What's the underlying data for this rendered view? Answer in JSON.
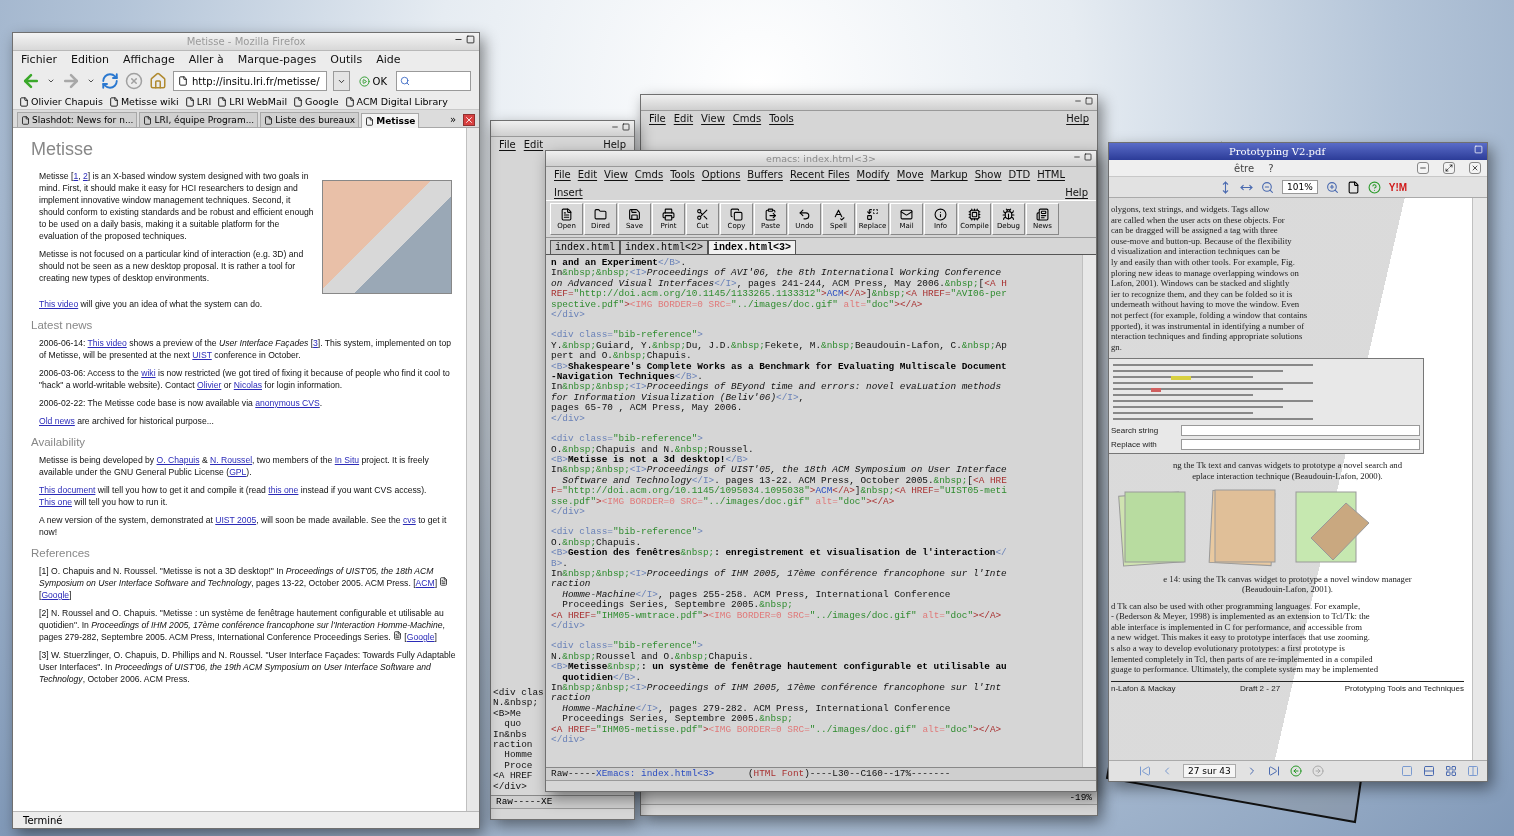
{
  "browser": {
    "title": "Metisse - Mozilla Firefox",
    "menu": [
      "Fichier",
      "Edition",
      "Affichage",
      "Aller à",
      "Marque-pages",
      "Outils",
      "Aide"
    ],
    "url": "http://insitu.lri.fr/metisse/",
    "go_label": "OK",
    "bookmarks": [
      "Olivier Chapuis",
      "Metisse wiki",
      "LRI",
      "LRI WebMail",
      "Google",
      "ACM Digital Library"
    ],
    "tabs": [
      {
        "label": "Slashdot: News for n...",
        "selected": false
      },
      {
        "label": "LRI, équipe Program...",
        "selected": false
      },
      {
        "label": "Liste des bureaux",
        "selected": false
      },
      {
        "label": "Metisse",
        "selected": true
      }
    ],
    "tabs_overflow": "»",
    "page": {
      "title": "Metisse",
      "intro": [
        [
          {
            "kind": "text",
            "text": "Metisse ["
          },
          {
            "kind": "link",
            "text": "1"
          },
          {
            "kind": "text",
            "text": ", "
          },
          {
            "kind": "link",
            "text": "2"
          },
          {
            "kind": "text",
            "text": "] is an X-based window system designed with two goals in mind. First, it should make it easy for HCI researchers to design and implement innovative window management techniques. Second, it should conform to existing standards and be robust and efficient enough to be used on a daily basis, making it a suitable platform for the evaluation of the proposed techniques."
          }
        ],
        [
          {
            "kind": "text",
            "text": "Metisse is not focused on a particular kind of interaction (e.g. 3D) and should not be seen as a new desktop proposal. It is rather a tool for creating new types of desktop environments."
          }
        ],
        [
          {
            "kind": "link",
            "text": "This video"
          },
          {
            "kind": "text",
            "text": " will give you an idea of what the system can do."
          }
        ]
      ],
      "sections": [
        {
          "heading": "Latest news",
          "paragraphs": [
            [
              {
                "kind": "text",
                "text": "2006-06-14: "
              },
              {
                "kind": "link",
                "text": "This video"
              },
              {
                "kind": "text",
                "text": " shows a preview of the "
              },
              {
                "kind": "italic",
                "text": "User Interface Façades"
              },
              {
                "kind": "text",
                "text": " ["
              },
              {
                "kind": "link",
                "text": "3"
              },
              {
                "kind": "text",
                "text": "]. This system, implemented on top of Metisse, will be presented at the next "
              },
              {
                "kind": "link",
                "text": "UIST"
              },
              {
                "kind": "text",
                "text": " conference in October."
              }
            ],
            [
              {
                "kind": "text",
                "text": "2006-03-06: Access to the "
              },
              {
                "kind": "link",
                "text": "wiki"
              },
              {
                "kind": "text",
                "text": " is now restricted (we got tired of fixing it because of people who find it cool to \"hack\" a world-writable website). Contact "
              },
              {
                "kind": "link",
                "text": "Olivier"
              },
              {
                "kind": "text",
                "text": " or "
              },
              {
                "kind": "link",
                "text": "Nicolas"
              },
              {
                "kind": "text",
                "text": " for login information."
              }
            ],
            [
              {
                "kind": "text",
                "text": "2006-02-22: The Metisse code base is now available via "
              },
              {
                "kind": "link",
                "text": "anonymous CVS"
              },
              {
                "kind": "text",
                "text": "."
              }
            ],
            [
              {
                "kind": "link",
                "text": "Old news"
              },
              {
                "kind": "text",
                "text": " are archived for historical purpose..."
              }
            ]
          ]
        },
        {
          "heading": "Availability",
          "paragraphs": [
            [
              {
                "kind": "text",
                "text": "Metisse is being developed by "
              },
              {
                "kind": "link",
                "text": "O. Chapuis"
              },
              {
                "kind": "text",
                "text": " & "
              },
              {
                "kind": "link",
                "text": "N. Roussel"
              },
              {
                "kind": "text",
                "text": ", two members of the "
              },
              {
                "kind": "link",
                "text": "In Situ"
              },
              {
                "kind": "text",
                "text": " project. It is freely available under the GNU General Public License ("
              },
              {
                "kind": "link",
                "text": "GPL"
              },
              {
                "kind": "text",
                "text": ")."
              }
            ],
            [
              {
                "kind": "link",
                "text": "This document"
              },
              {
                "kind": "text",
                "text": " will tell you how to get it and compile it (read "
              },
              {
                "kind": "link",
                "text": "this one"
              },
              {
                "kind": "text",
                "text": " instead if you want CVS access). "
              },
              {
                "kind": "link",
                "text": "This one"
              },
              {
                "kind": "text",
                "text": " will tell you how to run it."
              }
            ],
            [
              {
                "kind": "text",
                "text": "A new version of the system, demonstrated at "
              },
              {
                "kind": "link",
                "text": "UIST 2005"
              },
              {
                "kind": "text",
                "text": ", will soon be made available. See the "
              },
              {
                "kind": "link",
                "text": "cvs"
              },
              {
                "kind": "text",
                "text": " to get it now!"
              }
            ]
          ]
        },
        {
          "heading": "References",
          "paragraphs": [
            [
              {
                "kind": "text",
                "text": "[1] O. Chapuis and N. Roussel. \"Metisse is not a 3D desktop!\" In "
              },
              {
                "kind": "italic",
                "text": "Proceedings of UIST'05, the 18th ACM Symposium on User Interface Software and Technology"
              },
              {
                "kind": "text",
                "text": ", pages 13-22, October 2005. ACM Press. ["
              },
              {
                "kind": "link",
                "text": "ACM"
              },
              {
                "kind": "text",
                "text": "] "
              },
              {
                "kind": "icon"
              },
              {
                "kind": "text",
                "text": " ["
              },
              {
                "kind": "link",
                "text": "Google"
              },
              {
                "kind": "text",
                "text": "]"
              }
            ],
            [
              {
                "kind": "text",
                "text": "[2] N. Roussel and O. Chapuis. \"Metisse : un système de fenêtrage hautement configurable et utilisable au quotidien\". In "
              },
              {
                "kind": "italic",
                "text": "Proceedings of IHM 2005, 17ème conférence francophone sur l'Interaction Homme-Machine"
              },
              {
                "kind": "text",
                "text": ", pages 279-282, Septembre 2005. ACM Press, International Conference Proceedings Series. "
              },
              {
                "kind": "icon"
              },
              {
                "kind": "text",
                "text": " ["
              },
              {
                "kind": "link",
                "text": "Google"
              },
              {
                "kind": "text",
                "text": "]"
              }
            ],
            [
              {
                "kind": "text",
                "text": "[3] W. Stuerzlinger, O. Chapuis, D. Phillips and N. Roussel. \"User Interface Façades: Towards Fully Adaptable User Interfaces\". In "
              },
              {
                "kind": "italic",
                "text": "Proceedings of UIST'06, the 19th ACM Symposium on User Interface Software and Technology"
              },
              {
                "kind": "text",
                "text": ", October 2006. ACM Press."
              }
            ]
          ]
        }
      ]
    },
    "status": "Terminé"
  },
  "back_editors": [
    {
      "menu": [
        "File",
        "Edit"
      ],
      "help": "Help",
      "fragments": [
        "<div clas",
        "N.&nbsp;",
        "<B>Me",
        "  quo",
        "In&nbs",
        "raction",
        "  Homme",
        "  Proce",
        "<A HREF",
        "</div>"
      ],
      "mode_line": "Raw-----XE"
    },
    {
      "menu": [
        "File",
        "Edit",
        "View",
        "Cmds",
        "Tools"
      ],
      "help": "Help",
      "mode_line": "-19%"
    }
  ],
  "editor": {
    "title": "emacs: index.html<3>",
    "menu": [
      "File",
      "Edit",
      "View",
      "Cmds",
      "Tools",
      "Options",
      "Buffers",
      "Recent Files",
      "Modify",
      "Move",
      "Markup",
      "Show",
      "DTD",
      "HTML",
      "Insert"
    ],
    "help": "Help",
    "toolbar": [
      "Open",
      "Dired",
      "Save",
      "Print",
      "Cut",
      "Copy",
      "Paste",
      "Undo",
      "Spell",
      "Replace",
      "Mail",
      "Info",
      "Compile",
      "Debug",
      "News"
    ],
    "buffers": [
      {
        "label": "index.html",
        "selected": false
      },
      {
        "label": "index.html<2>",
        "selected": false
      },
      {
        "label": "index.html<3>",
        "selected": true
      }
    ],
    "blocks": [
      [
        [
          {
            "kind": "bold",
            "text": "n and an Experiment"
          },
          {
            "kind": "tag",
            "text": "</B>"
          },
          {
            "kind": "text",
            "text": "."
          }
        ],
        [
          {
            "kind": "text",
            "text": "In"
          },
          {
            "kind": "string",
            "text": "&nbsp;&nbsp;"
          },
          {
            "kind": "tag",
            "text": "<I>"
          },
          {
            "kind": "italic",
            "text": "Proceedings of AVI'06, the 8th International Working Conference"
          }
        ],
        [
          {
            "kind": "italic",
            "text": "on Advanced Visual Interfaces"
          },
          {
            "kind": "tag",
            "text": "</I>"
          },
          {
            "kind": "text",
            "text": ", pages 241-244, ACM Press, May 2006."
          },
          {
            "kind": "string",
            "text": "&nbsp;"
          },
          {
            "kind": "text",
            "text": "["
          },
          {
            "kind": "anchor",
            "text": "<A H"
          }
        ],
        [
          {
            "kind": "anchor",
            "text": "REF="
          },
          {
            "kind": "string",
            "text": "\"http://doi.acm.org/10.1145/1133265.1133312\""
          },
          {
            "kind": "anchor",
            "text": ">"
          },
          {
            "kind": "link",
            "text": "ACM"
          },
          {
            "kind": "anchor",
            "text": "</A>"
          },
          {
            "kind": "text",
            "text": "]"
          },
          {
            "kind": "string",
            "text": "&nbsp;"
          },
          {
            "kind": "anchor",
            "text": "<A HREF="
          },
          {
            "kind": "string",
            "text": "\"AVI06-per"
          }
        ],
        [
          {
            "kind": "string",
            "text": "spective.pdf\""
          },
          {
            "kind": "anchor",
            "text": ">"
          },
          {
            "kind": "attr",
            "text": "<IMG BORDER=0 SRC="
          },
          {
            "kind": "string",
            "text": "\"../images/doc.gif\""
          },
          {
            "kind": "attr",
            "text": " alt="
          },
          {
            "kind": "string",
            "text": "\"doc\""
          },
          {
            "kind": "anchor",
            "text": "></A>"
          }
        ],
        [
          {
            "kind": "tag",
            "text": "</div>"
          }
        ]
      ],
      [
        [
          {
            "kind": "tag",
            "text": "<div class="
          },
          {
            "kind": "string",
            "text": "\"bib-reference\""
          },
          {
            "kind": "tag",
            "text": ">"
          }
        ],
        [
          {
            "kind": "text",
            "text": "Y."
          },
          {
            "kind": "string",
            "text": "&nbsp;"
          },
          {
            "kind": "text",
            "text": "Guiard, Y."
          },
          {
            "kind": "string",
            "text": "&nbsp;"
          },
          {
            "kind": "text",
            "text": "Du, J.D."
          },
          {
            "kind": "string",
            "text": "&nbsp;"
          },
          {
            "kind": "text",
            "text": "Fekete, M."
          },
          {
            "kind": "string",
            "text": "&nbsp;"
          },
          {
            "kind": "text",
            "text": "Beaudouin-Lafon, C."
          },
          {
            "kind": "string",
            "text": "&nbsp;"
          },
          {
            "kind": "text",
            "text": "Ap"
          }
        ],
        [
          {
            "kind": "text",
            "text": "pert and O."
          },
          {
            "kind": "string",
            "text": "&nbsp;"
          },
          {
            "kind": "text",
            "text": "Chapuis."
          }
        ],
        [
          {
            "kind": "tag",
            "text": "<B>"
          },
          {
            "kind": "bold",
            "text": "Shakespeare's Complete Works as a Benchmark for Evaluating Multiscale Document"
          }
        ],
        [
          {
            "kind": "bold",
            "text": "-Navigation Techniques"
          },
          {
            "kind": "tag",
            "text": "</B>"
          },
          {
            "kind": "text",
            "text": "."
          }
        ],
        [
          {
            "kind": "text",
            "text": "In"
          },
          {
            "kind": "string",
            "text": "&nbsp;&nbsp;"
          },
          {
            "kind": "tag",
            "text": "<I>"
          },
          {
            "kind": "italic",
            "text": "Proceedings of BEyond time and errors: novel evaLuation methods"
          }
        ],
        [
          {
            "kind": "italic",
            "text": "for Information Visualization (Beliv'06)"
          },
          {
            "kind": "tag",
            "text": "</I>"
          },
          {
            "kind": "text",
            "text": ","
          }
        ],
        [
          {
            "kind": "text",
            "text": "pages 65-70 , ACM Press, May 2006."
          }
        ],
        [
          {
            "kind": "tag",
            "text": "</div>"
          }
        ]
      ],
      [
        [
          {
            "kind": "tag",
            "text": "<div class="
          },
          {
            "kind": "string",
            "text": "\"bib-reference\""
          },
          {
            "kind": "tag",
            "text": ">"
          }
        ],
        [
          {
            "kind": "text",
            "text": "O."
          },
          {
            "kind": "string",
            "text": "&nbsp;"
          },
          {
            "kind": "text",
            "text": "Chapuis and N."
          },
          {
            "kind": "string",
            "text": "&nbsp;"
          },
          {
            "kind": "text",
            "text": "Roussel."
          }
        ],
        [
          {
            "kind": "tag",
            "text": "<B>"
          },
          {
            "kind": "bold",
            "text": "Metisse is not a 3d desktop!"
          },
          {
            "kind": "tag",
            "text": "</B>"
          }
        ],
        [
          {
            "kind": "text",
            "text": "In"
          },
          {
            "kind": "string",
            "text": "&nbsp;&nbsp;"
          },
          {
            "kind": "tag",
            "text": "<I>"
          },
          {
            "kind": "italic",
            "text": "Proceedings of UIST'05, the 18th ACM Symposium on User Interface"
          }
        ],
        [
          {
            "kind": "italic",
            "text": "  Software and Technology"
          },
          {
            "kind": "tag",
            "text": "</I>"
          },
          {
            "kind": "text",
            "text": ". pages 13-22. ACM Press, October 2005."
          },
          {
            "kind": "string",
            "text": "&nbsp;"
          },
          {
            "kind": "text",
            "text": "["
          },
          {
            "kind": "anchor",
            "text": "<A HRE"
          }
        ],
        [
          {
            "kind": "anchor",
            "text": "F="
          },
          {
            "kind": "string",
            "text": "\"http://doi.acm.org/10.1145/1095034.1095038\""
          },
          {
            "kind": "anchor",
            "text": ">"
          },
          {
            "kind": "link",
            "text": "ACM"
          },
          {
            "kind": "anchor",
            "text": "</A>"
          },
          {
            "kind": "text",
            "text": "]"
          },
          {
            "kind": "string",
            "text": "&nbsp;"
          },
          {
            "kind": "anchor",
            "text": "<A HREF="
          },
          {
            "kind": "string",
            "text": "\"UIST05-meti"
          }
        ],
        [
          {
            "kind": "string",
            "text": "sse.pdf\""
          },
          {
            "kind": "anchor",
            "text": ">"
          },
          {
            "kind": "attr",
            "text": "<IMG BORDER=0 SRC="
          },
          {
            "kind": "string",
            "text": "\"../images/doc.gif\""
          },
          {
            "kind": "attr",
            "text": " alt="
          },
          {
            "kind": "string",
            "text": "\"doc\""
          },
          {
            "kind": "anchor",
            "text": "></A>"
          }
        ],
        [
          {
            "kind": "tag",
            "text": "</div>"
          }
        ]
      ],
      [
        [
          {
            "kind": "tag",
            "text": "<div class="
          },
          {
            "kind": "string",
            "text": "\"bib-reference\""
          },
          {
            "kind": "tag",
            "text": ">"
          }
        ],
        [
          {
            "kind": "text",
            "text": "O."
          },
          {
            "kind": "string",
            "text": "&nbsp;"
          },
          {
            "kind": "text",
            "text": "Chapuis."
          }
        ],
        [
          {
            "kind": "tag",
            "text": "<B>"
          },
          {
            "kind": "bold",
            "text": "Gestion des fenêtres"
          },
          {
            "kind": "string",
            "text": "&nbsp;"
          },
          {
            "kind": "bold",
            "text": ": enregistrement et visualisation de l'interaction"
          },
          {
            "kind": "tag",
            "text": "</"
          }
        ],
        [
          {
            "kind": "tag",
            "text": "B>"
          },
          {
            "kind": "text",
            "text": "."
          }
        ],
        [
          {
            "kind": "text",
            "text": "In"
          },
          {
            "kind": "string",
            "text": "&nbsp;&nbsp;"
          },
          {
            "kind": "tag",
            "text": "<I>"
          },
          {
            "kind": "italic",
            "text": "Proceedings of IHM 2005, 17ème conférence francophone sur l'Inte"
          }
        ],
        [
          {
            "kind": "italic",
            "text": "raction"
          }
        ],
        [
          {
            "kind": "italic",
            "text": "  Homme-Machine"
          },
          {
            "kind": "tag",
            "text": "</I>"
          },
          {
            "kind": "text",
            "text": ", pages 255-258. ACM Press, International Conference"
          }
        ],
        [
          {
            "kind": "text",
            "text": "  Proceedings Series, Septembre 2005."
          },
          {
            "kind": "string",
            "text": "&nbsp;"
          }
        ],
        [
          {
            "kind": "anchor",
            "text": "<A HREF="
          },
          {
            "kind": "string",
            "text": "\"IHM05-wmtrace.pdf\""
          },
          {
            "kind": "anchor",
            "text": ">"
          },
          {
            "kind": "attr",
            "text": "<IMG BORDER=0 SRC="
          },
          {
            "kind": "string",
            "text": "\"../images/doc.gif\""
          },
          {
            "kind": "attr",
            "text": " alt="
          },
          {
            "kind": "string",
            "text": "\"doc\""
          },
          {
            "kind": "anchor",
            "text": "></A>"
          }
        ],
        [
          {
            "kind": "tag",
            "text": "</div>"
          }
        ]
      ],
      [
        [
          {
            "kind": "tag",
            "text": "<div class="
          },
          {
            "kind": "string",
            "text": "\"bib-reference\""
          },
          {
            "kind": "tag",
            "text": ">"
          }
        ],
        [
          {
            "kind": "text",
            "text": "N."
          },
          {
            "kind": "string",
            "text": "&nbsp;"
          },
          {
            "kind": "text",
            "text": "Roussel and O."
          },
          {
            "kind": "string",
            "text": "&nbsp;"
          },
          {
            "kind": "text",
            "text": "Chapuis."
          }
        ],
        [
          {
            "kind": "tag",
            "text": "<B>"
          },
          {
            "kind": "bold",
            "text": "Metisse"
          },
          {
            "kind": "string",
            "text": "&nbsp;"
          },
          {
            "kind": "bold",
            "text": ": un système de fenêtrage hautement configurable et utilisable au"
          }
        ],
        [
          {
            "kind": "bold",
            "text": "  quotidien"
          },
          {
            "kind": "tag",
            "text": "</B>"
          },
          {
            "kind": "text",
            "text": "."
          }
        ],
        [
          {
            "kind": "text",
            "text": "In"
          },
          {
            "kind": "string",
            "text": "&nbsp;&nbsp;"
          },
          {
            "kind": "tag",
            "text": "<I>"
          },
          {
            "kind": "italic",
            "text": "Proceedings of IHM 2005, 17ème conférence francophone sur l'Int"
          }
        ],
        [
          {
            "kind": "italic",
            "text": "raction"
          }
        ],
        [
          {
            "kind": "italic",
            "text": "  Homme-Machine"
          },
          {
            "kind": "tag",
            "text": "</I>"
          },
          {
            "kind": "text",
            "text": ", pages 279-282. ACM Press, International Conference"
          }
        ],
        [
          {
            "kind": "text",
            "text": "  Proceedings Series, Septembre 2005."
          },
          {
            "kind": "string",
            "text": "&nbsp;"
          }
        ],
        [
          {
            "kind": "anchor",
            "text": "<A HREF="
          },
          {
            "kind": "string",
            "text": "\"IHM05-metisse.pdf\""
          },
          {
            "kind": "anchor",
            "text": ">"
          },
          {
            "kind": "attr",
            "text": "<IMG BORDER=0 SRC="
          },
          {
            "kind": "string",
            "text": "\"../images/doc.gif\""
          },
          {
            "kind": "attr",
            "text": " alt="
          },
          {
            "kind": "string",
            "text": "\"doc\""
          },
          {
            "kind": "anchor",
            "text": "></A>"
          }
        ],
        [
          {
            "kind": "tag",
            "text": "</div>"
          }
        ]
      ]
    ],
    "mode_line": [
      {
        "kind": "text",
        "text": "Raw-----"
      },
      {
        "kind": "link",
        "text": "XEmacs: index.html<3>"
      },
      {
        "kind": "text",
        "text": "      ("
      },
      {
        "kind": "anchor",
        "text": "HTML Font"
      },
      {
        "kind": "text",
        "text": ")----L30--C160--17%-------"
      }
    ]
  },
  "viewer": {
    "title": "Prototyping V2.pdf",
    "menu": [
      "être",
      "?"
    ],
    "zoom": "101%",
    "messenger": "Y!M",
    "paragraph_1": [
      "olygons, text strings, and widgets. Tags allow",
      "are called when the user acts on these objects. For",
      "can be dragged will be assigned a tag with three",
      "ouse-move and button-up. Because of the flexibility",
      "d visualization and interaction techniques can be",
      "ly and easily than with other tools. For example, Fig.",
      "ploring new ideas to manage overlapping windows on",
      "Lafon, 2001). Windows can be stacked and slightly",
      "ier to recognize them, and they can be folded so it is",
      "underneath without having to move the window. Even",
      "not perfect (for example, folding a window that contains",
      "pported), it was instrumental in identifying a number of",
      "nteraction techniques and finding appropriate solutions",
      "gn."
    ],
    "figure_fields": [
      "Search string",
      "Replace with"
    ],
    "caption_1": [
      "ng the Tk text and canvas widgets to prototype a novel search and",
      "eplace interaction technique (Beaudouin-Lafon, 2000)."
    ],
    "caption_2": [
      "e 14: using the Tk canvas widget to prototype a novel window manager",
      "(Beaudouin-Lafon, 2001)."
    ],
    "paragraph_2": [
      "d Tk can also be used with other programming languages. For example,",
      "- (Bederson & Meyer, 1998) is implemented as an extension to Tcl/Tk: the",
      "able interface is implemented in C for performance, and accessible from",
      "a new widget. This makes it easy to prototype interfaces that use zooming.",
      "s also a way to develop evolutionary prototypes: a first prototype is",
      "lemented completely in Tcl, then parts of are re-implemented in a compiled",
      "guage to performance. Ultimately, the complete system may be implemented"
    ],
    "footer": [
      "n-Lafon & Mackay",
      "Draft 2 - 27",
      "Prototyping Tools and Techniques"
    ],
    "page_field": "27 sur 43"
  }
}
